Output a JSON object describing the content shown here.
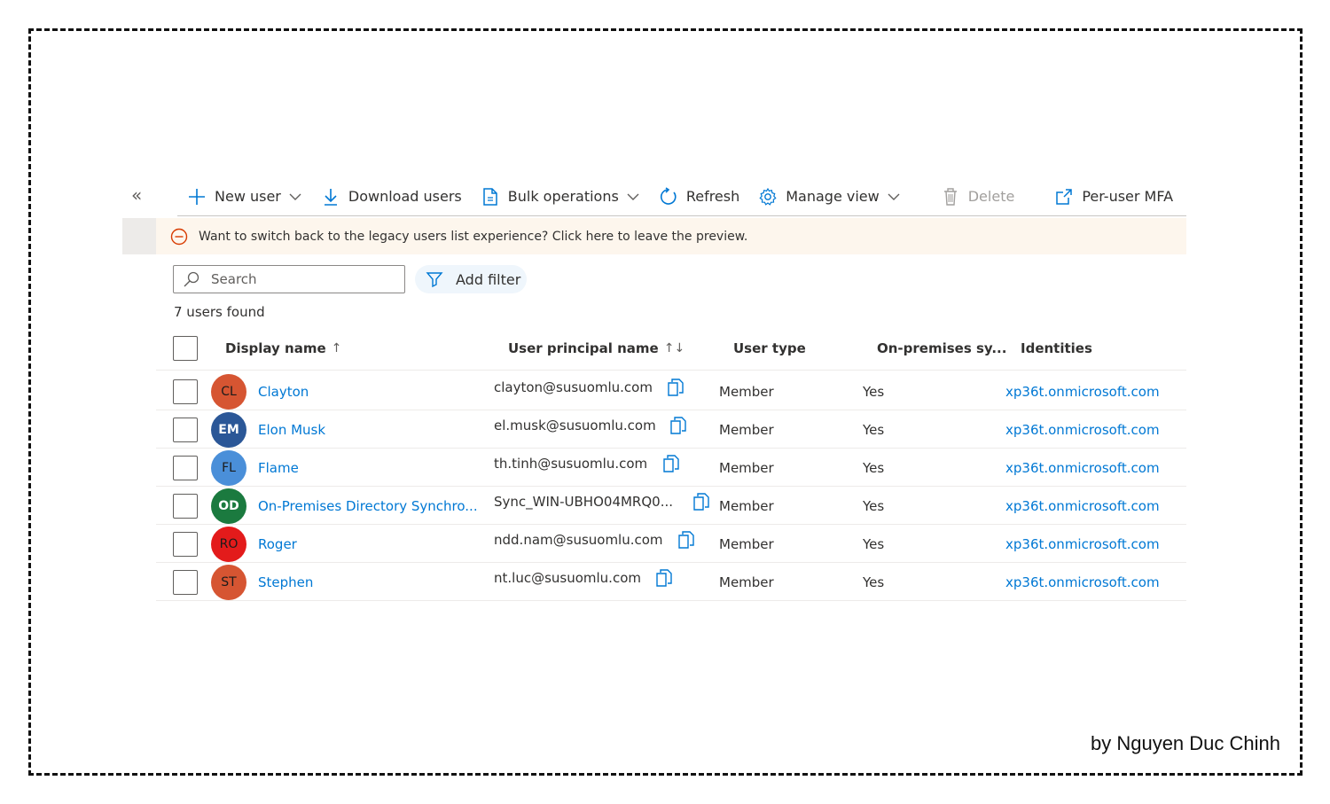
{
  "toolbar": {
    "collapse_glyph": "«",
    "new_user": "New user",
    "download_users": "Download users",
    "bulk_operations": "Bulk operations",
    "refresh": "Refresh",
    "manage_view": "Manage view",
    "delete": "Delete",
    "per_user_mfa": "Per-user MFA"
  },
  "banner": {
    "text": "Want to switch back to the legacy users list experience? Click here to leave the preview."
  },
  "search": {
    "placeholder": "Search",
    "value": ""
  },
  "filter": {
    "label": "Add filter"
  },
  "count": "7 users found",
  "columns": {
    "display_name": "Display name",
    "display_name_sort": "↑",
    "upn": "User principal name",
    "upn_sort": "↑↓",
    "user_type": "User type",
    "onprem": "On-premises sy...",
    "identities": "Identities"
  },
  "users": [
    {
      "initials": "CL",
      "name": "Clayton",
      "upn": "clayton@susuomlu.com",
      "type": "Member",
      "onprem": "Yes",
      "identity": "xp36t.onmicrosoft.com",
      "avatar_color": "#d65532",
      "light": false
    },
    {
      "initials": "EM",
      "name": "Elon Musk",
      "upn": "el.musk@susuomlu.com",
      "type": "Member",
      "onprem": "Yes",
      "identity": "xp36t.onmicrosoft.com",
      "avatar_color": "#2b5797",
      "light": true
    },
    {
      "initials": "FL",
      "name": "Flame",
      "upn": "th.tinh@susuomlu.com",
      "type": "Member",
      "onprem": "Yes",
      "identity": "xp36t.onmicrosoft.com",
      "avatar_color": "#4a8fd9",
      "light": false
    },
    {
      "initials": "OD",
      "name": "On-Premises Directory Synchro...",
      "upn": "Sync_WIN-UBHO04MRQ0...",
      "type": "Member",
      "onprem": "Yes",
      "identity": "xp36t.onmicrosoft.com",
      "avatar_color": "#1b7a3f",
      "light": true
    },
    {
      "initials": "RO",
      "name": "Roger",
      "upn": "ndd.nam@susuomlu.com",
      "type": "Member",
      "onprem": "Yes",
      "identity": "xp36t.onmicrosoft.com",
      "avatar_color": "#e31b1b",
      "light": false
    },
    {
      "initials": "ST",
      "name": "Stephen",
      "upn": "nt.luc@susuomlu.com",
      "type": "Member",
      "onprem": "Yes",
      "identity": "xp36t.onmicrosoft.com",
      "avatar_color": "#d65532",
      "light": false
    }
  ],
  "credit": "by Nguyen Duc Chinh",
  "colors": {
    "accent": "#0078d4",
    "banner_bg": "#fdf6ed",
    "banner_icon": "#d83b01"
  }
}
